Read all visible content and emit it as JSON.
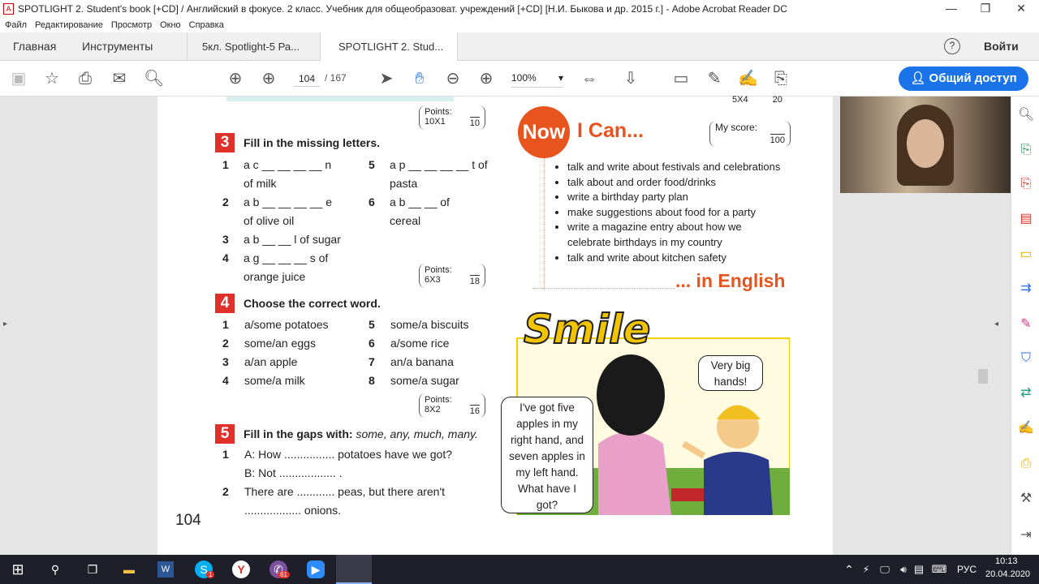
{
  "window": {
    "title": "SPOTLIGHT 2. Student's book [+CD] / Английский в фокусе. 2 класс. Учебник для общеобразоват. учреждений [+CD] [Н.И. Быкова и др. 2015 г.] - Adobe Acrobat Reader DC",
    "app_icon": "pdf-icon",
    "minimize": "—",
    "restore": "❐",
    "close": "✕"
  },
  "menu": [
    "Файл",
    "Редактирование",
    "Просмотр",
    "Окно",
    "Справка"
  ],
  "tabs": {
    "home": "Главная",
    "tools": "Инструменты",
    "doc1": "5кл. Spotlight-5 Ра...",
    "doc2": "SPOTLIGHT 2. Stud...",
    "close": "×",
    "help": "?",
    "signin": "Войти"
  },
  "toolbar": {
    "page_current": "104",
    "page_total": "/ 167",
    "zoom": "100%",
    "share": "Общий доступ",
    "accent": "#1a73e8"
  },
  "document": {
    "points_top": {
      "label": "Points:",
      "calc": "10X1",
      "max": "10"
    },
    "ex3": {
      "number": "3",
      "title": "Fill in the missing letters.",
      "items": [
        {
          "n": "1",
          "l1": "a c __ __ __ __ n",
          "l2": "of milk"
        },
        {
          "n": "2",
          "l1": "a b __ __ __ __ e",
          "l2": "of olive oil"
        },
        {
          "n": "3",
          "l1": "a b __ __ l of sugar",
          "l2": ""
        },
        {
          "n": "4",
          "l1": "a g __ __ __ s of",
          "l2": "orange juice"
        },
        {
          "n": "5",
          "l1": "a p __ __ __ __ t of",
          "l2": "pasta"
        },
        {
          "n": "6",
          "l1": "a  b  __  __  of",
          "l2": "cereal"
        }
      ],
      "points": {
        "label": "Points:",
        "calc": "6X3",
        "max": "18"
      }
    },
    "ex4": {
      "number": "4",
      "title": "Choose the correct word.",
      "items": [
        {
          "n": "1",
          "t": "a/some potatoes"
        },
        {
          "n": "2",
          "t": "some/an eggs"
        },
        {
          "n": "3",
          "t": "a/an apple"
        },
        {
          "n": "4",
          "t": "some/a milk"
        },
        {
          "n": "5",
          "t": "some/a biscuits"
        },
        {
          "n": "6",
          "t": "a/some rice"
        },
        {
          "n": "7",
          "t": "an/a banana"
        },
        {
          "n": "8",
          "t": "some/a sugar"
        }
      ],
      "points": {
        "label": "Points:",
        "calc": "8X2",
        "max": "16"
      }
    },
    "ex5": {
      "number": "5",
      "title": "Fill in the gaps with:",
      "words": "some, any, much, many.",
      "items": [
        {
          "n": "1",
          "l1": "A: How ................ potatoes have we got?",
          "l2": "B: Not .................. ."
        },
        {
          "n": "2",
          "l1": "There are ............ peas,  but there aren't",
          "l2": ".................. onions."
        }
      ]
    },
    "page_number": "104",
    "points_right": {
      "calc": "5X4",
      "max": "20"
    },
    "now_i_can": {
      "now": "Now",
      "title": "I Can...",
      "score_label": "My score:",
      "score_max": "100",
      "items": [
        "talk and write about festivals and celebrations",
        "talk about and order food/drinks",
        "write a birthday party plan",
        "make suggestions about food for a party",
        "write a magazine entry about how we celebrate birthdays in my country",
        "talk and write about kitchen safety"
      ],
      "footer": "... in English",
      "accent": "#e8541e"
    },
    "smile": {
      "title": "Smile",
      "bubble_boy": "Very big hands!",
      "bubble_girl": "I've got five apples in my right hand, and seven apples in my left hand. What have I got?"
    }
  },
  "taskbar": {
    "lang": "РУС",
    "time": "10:13",
    "date": "20.04.2020",
    "badge_skype": "1",
    "badge_viber": "61"
  }
}
